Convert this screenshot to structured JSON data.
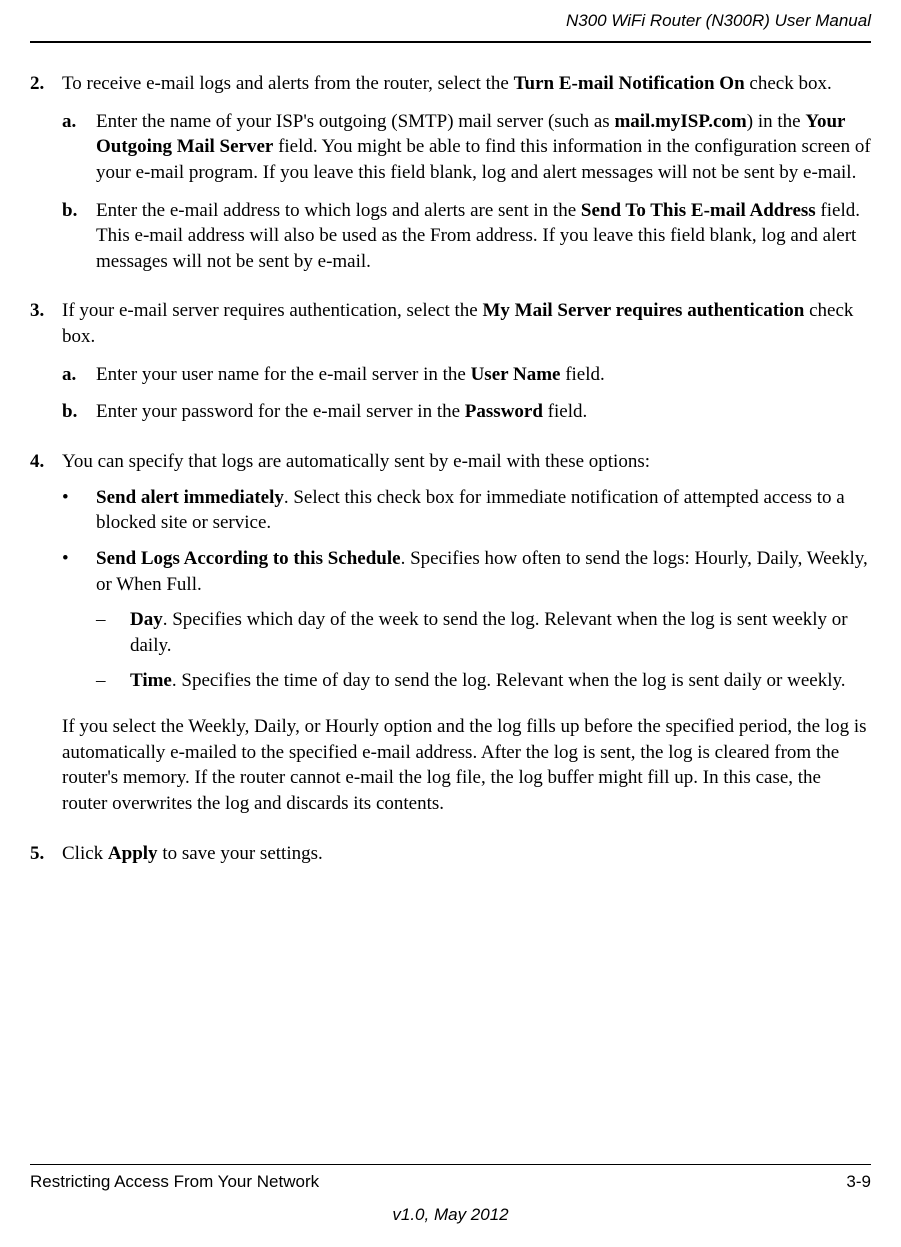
{
  "header": {
    "title": "N300 WiFi Router (N300R) User Manual"
  },
  "steps": {
    "s2": {
      "num": "2.",
      "text_before": "To receive e-mail logs and alerts from the router, select the ",
      "bold1": "Turn E-mail Notification On",
      "text_after": " check box.",
      "a": {
        "num": "a.",
        "t1": "Enter the name of your ISP's outgoing (SMTP) mail server (such as ",
        "b1": "mail.myISP.com",
        "t2": ") in the ",
        "b2": "Your Outgoing Mail Server",
        "t3": " field. You might be able to find this information in the configuration screen of your e-mail program. If you leave this field blank, log and alert messages will not be sent by e-mail."
      },
      "b": {
        "num": "b.",
        "t1": "Enter the e-mail address to which logs and alerts are sent in the ",
        "b1": "Send To This E-mail Address",
        "t2": " field. This e-mail address will also be used as the From address. If you leave this field blank, log and alert messages will not be sent by e-mail."
      }
    },
    "s3": {
      "num": "3.",
      "t1": "If your e-mail server requires authentication, select the ",
      "b1": "My Mail Server requires authentication",
      "t2": " check box.",
      "a": {
        "num": "a.",
        "t1": "Enter your user name for the e-mail server in the ",
        "b1": "User Name",
        "t2": " field."
      },
      "b": {
        "num": "b.",
        "t1": "Enter your password for the e-mail server in the ",
        "b1": "Password",
        "t2": " field."
      }
    },
    "s4": {
      "num": "4.",
      "t1": "You can specify that logs are automatically sent by e-mail with these options:",
      "bullet1": {
        "mark": "•",
        "b1": "Send alert immediately",
        "t1": ". Select this check box for immediate notification of attempted access to a blocked site or service."
      },
      "bullet2": {
        "mark": "•",
        "b1": "Send Logs According to this Schedule",
        "t1": ". Specifies how often to send the logs: Hourly, Daily, Weekly, or When Full."
      },
      "dash1": {
        "mark": "–",
        "b1": "Day",
        "t1": ". Specifies which day of the week to send the log. Relevant when the log is sent weekly or daily."
      },
      "dash2": {
        "mark": "–",
        "b1": "Time",
        "t1": ". Specifies the time of day to send the log. Relevant when the log is sent daily or weekly."
      },
      "after": "If you select the Weekly, Daily, or Hourly option and the log fills up before the specified period, the log is automatically e-mailed to the specified e-mail address. After the log is sent, the log is cleared from the router's memory. If the router cannot e-mail the log file, the log buffer might fill up. In this case, the router overwrites the log and discards its contents."
    },
    "s5": {
      "num": "5.",
      "t1": "Click ",
      "b1": "Apply",
      "t2": " to save your settings."
    }
  },
  "footer": {
    "left": "Restricting Access From Your Network",
    "right": "3-9",
    "version": "v1.0, May 2012"
  }
}
